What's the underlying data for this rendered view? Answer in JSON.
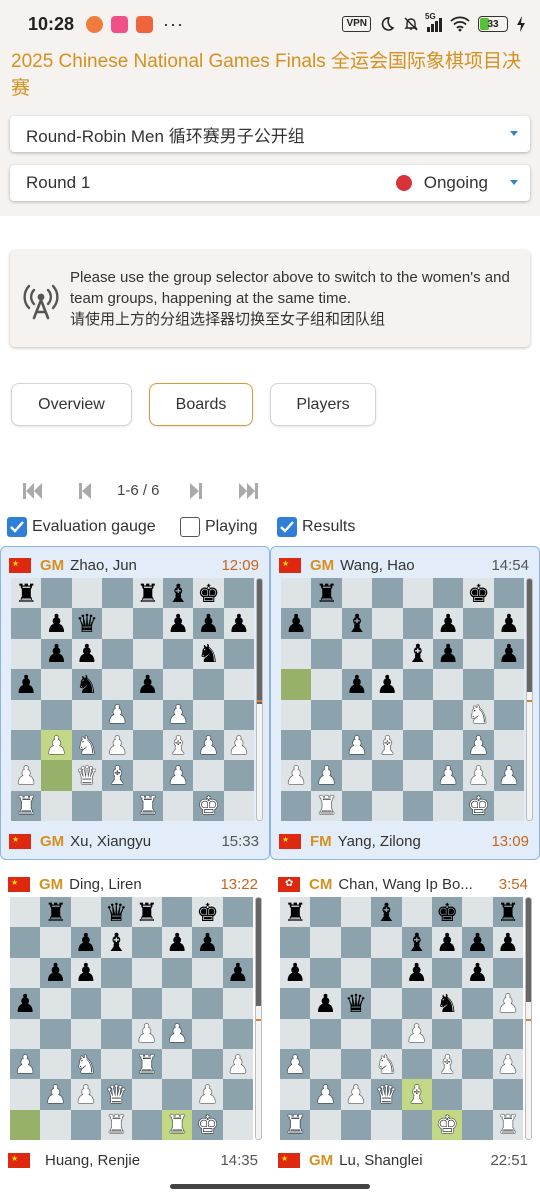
{
  "status_bar": {
    "time": "10:28",
    "more": "···",
    "vpn": "VPN",
    "network": "5G",
    "battery": "33"
  },
  "header": {
    "title": "2025 Chinese National Games Finals 全运会国际象棋项目决赛",
    "group_select": "Round-Robin Men 循环赛男子公开组",
    "round_select": "Round 1",
    "round_status": "Ongoing"
  },
  "info": {
    "text_en": "Please use the group selector above to switch to the women's and team groups, happening at the same time.",
    "text_zh": "请使用上方的分组选择器切换至女子组和团队组"
  },
  "tabs": [
    {
      "label": "Overview",
      "active": false
    },
    {
      "label": "Boards",
      "active": true
    },
    {
      "label": "Players",
      "active": false
    }
  ],
  "pager": {
    "label": "1-6 / 6"
  },
  "options": [
    {
      "label": "Evaluation gauge",
      "checked": true
    },
    {
      "label": "Playing",
      "checked": false
    },
    {
      "label": "Results",
      "checked": true
    }
  ],
  "colors": {
    "accent": "#d59120",
    "ongoing": "#d8333b",
    "link": "#2f7fd9",
    "board_light": "#dee3e6",
    "board_dark": "#8ca2ad"
  },
  "games": [
    {
      "top": {
        "flag": "cn",
        "title": "GM",
        "name": "Zhao, Jun",
        "clock": "12:09",
        "running": true
      },
      "bottom": {
        "flag": "cn",
        "title": "GM",
        "name": "Xu, Xiangyu",
        "clock": "15:33",
        "running": false
      },
      "rows": [
        "r...rbk.",
        ".pq..ppp",
        ".pp...n.",
        "p.n.p...",
        "...P.P..",
        ".PNP.BPP",
        "P.QB.P..",
        "R...R.K."
      ],
      "highlight": [
        "b3",
        "b2"
      ],
      "gauge": 0.52
    },
    {
      "top": {
        "flag": "cn",
        "title": "GM",
        "name": "Wang, Hao",
        "clock": "14:54",
        "running": false
      },
      "bottom": {
        "flag": "cn",
        "title": "FM",
        "name": "Yang, Zilong",
        "clock": "13:09",
        "running": true
      },
      "rows": [
        ".r....k.",
        "p.b..p.p",
        "....bp.p",
        "..pp....",
        "......N.",
        "..PB..P.",
        "PP...PPP",
        ".R....K."
      ],
      "highlight": [
        "a5"
      ],
      "gauge": 0.47
    },
    {
      "top": {
        "flag": "cn",
        "title": "GM",
        "name": "Ding, Liren",
        "clock": "13:22",
        "running": true
      },
      "bottom": {
        "flag": "cn",
        "title": "",
        "name": "Huang, Renjie",
        "clock": "14:35",
        "running": false
      },
      "rows": [
        ".r.qr.k.",
        "..pb.pp.",
        ".pp....p",
        "p.......",
        "....PP..",
        "P.N.R..P",
        ".PPQ..P.",
        "...R.RK."
      ],
      "highlight": [
        "a1",
        "f1"
      ],
      "gauge": 0.45
    },
    {
      "top": {
        "flag": "hk",
        "title": "CM",
        "name": "Chan, Wang Ip Bo...",
        "clock": "3:54",
        "running": true
      },
      "bottom": {
        "flag": "cn",
        "title": "GM",
        "name": "Lu, Shanglei",
        "clock": "22:51",
        "running": false
      },
      "rows": [
        "r..b.k.r",
        "....bppp",
        "p...p.p.",
        ".pq..n.P",
        "....P...",
        "P..N.B.P",
        ".PPQB...",
        "R....K.R"
      ],
      "highlight": [
        "e2",
        "f1"
      ],
      "gauge": 0.43
    }
  ]
}
